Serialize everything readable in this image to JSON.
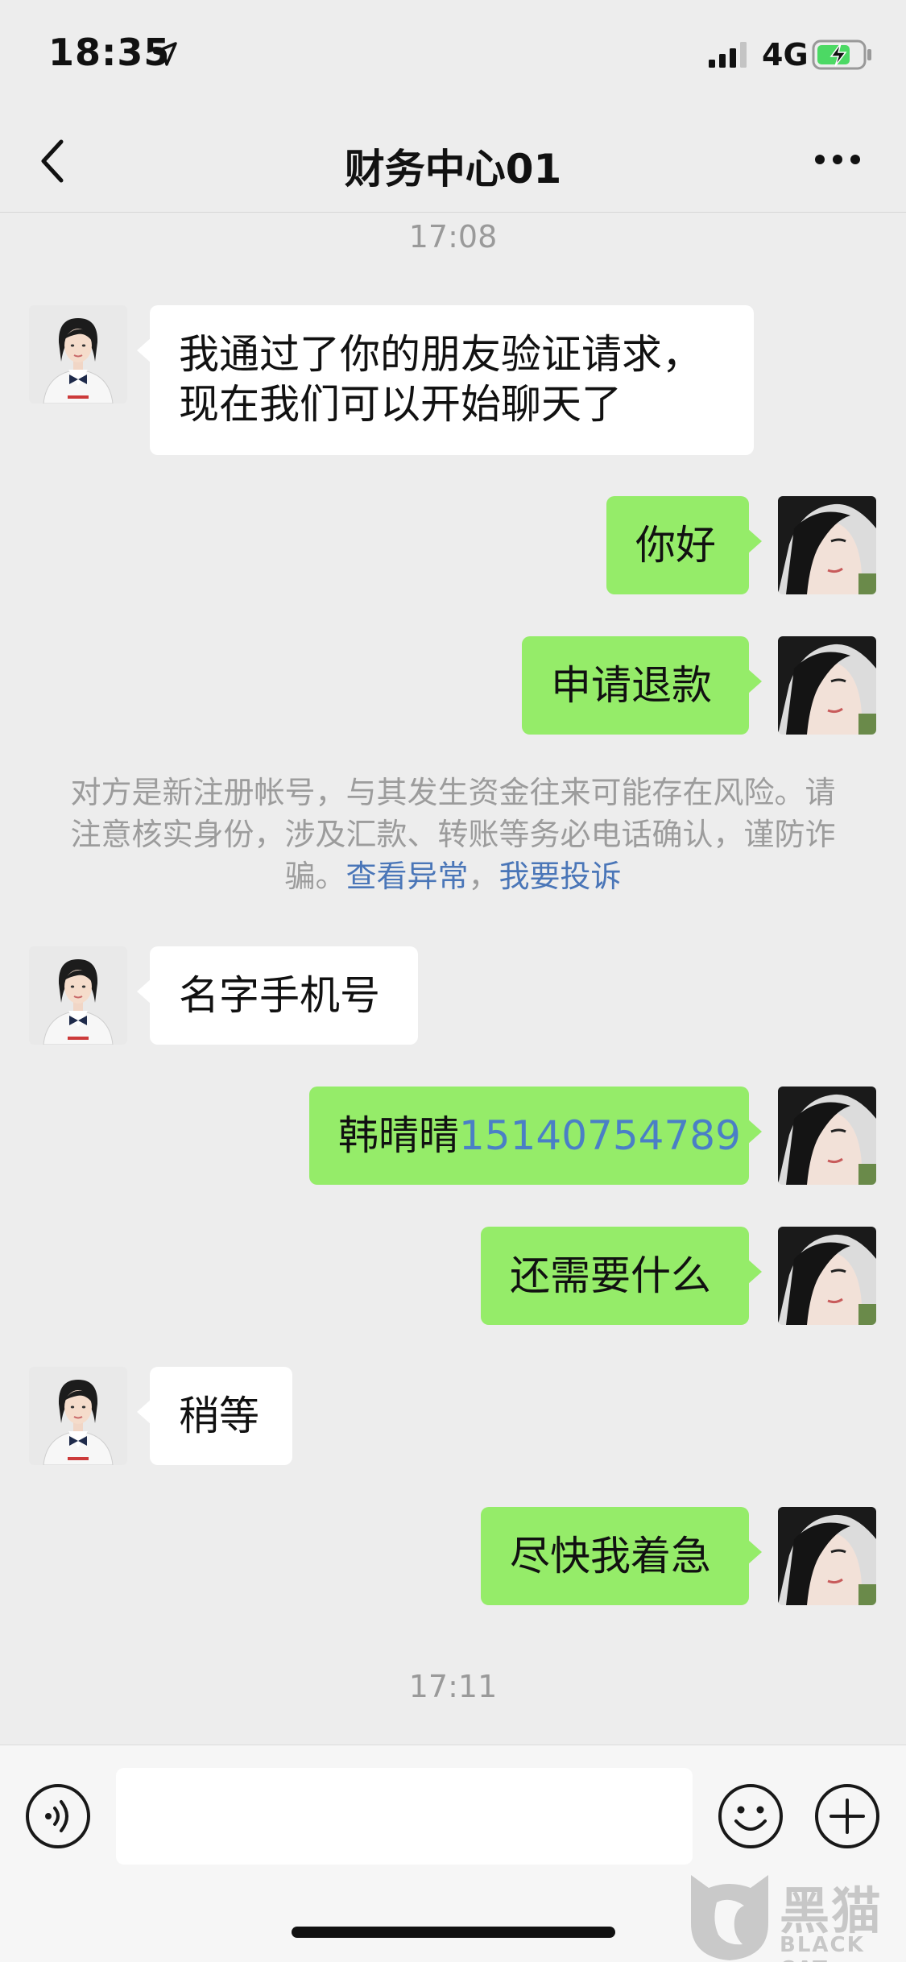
{
  "status_bar": {
    "time": "18:35",
    "network": "4G"
  },
  "nav": {
    "title": "财务中心01"
  },
  "timestamps": [
    "17:08",
    "17:11"
  ],
  "messages": [
    {
      "side": "left",
      "lines": [
        "我通过了你的朋友验证请求，",
        "现在我们可以开始聊天了"
      ]
    },
    {
      "side": "right",
      "text": "你好"
    },
    {
      "side": "right",
      "text": "申请退款"
    },
    {
      "side": "left",
      "text": "名字手机号"
    },
    {
      "side": "right",
      "name": "韩晴晴",
      "phone": "15140754789"
    },
    {
      "side": "right",
      "text": "还需要什么"
    },
    {
      "side": "left",
      "text": "稍等"
    },
    {
      "side": "right",
      "text": "尽快我着急"
    }
  ],
  "system_notice": {
    "text": "对方是新注册帐号，与其发生资金往来可能存在风险。请注意核实身份，涉及汇款、转账等务必电话确认，谨防诈骗。",
    "link_anomaly": "查看异常",
    "separator": "，",
    "link_complaint": "我要投诉"
  },
  "watermark": {
    "text": "黑猫",
    "sub": "BLACK CAT"
  },
  "colors": {
    "sent_bubble": "#95ec69",
    "received_bubble": "#ffffff",
    "background": "#ededed",
    "link": "#4a76b8"
  },
  "icons": [
    "location-arrow-icon",
    "signal-icon",
    "battery-charging-icon",
    "back-chevron-icon",
    "more-dots-icon",
    "voice-icon",
    "emoji-icon",
    "add-icon"
  ]
}
